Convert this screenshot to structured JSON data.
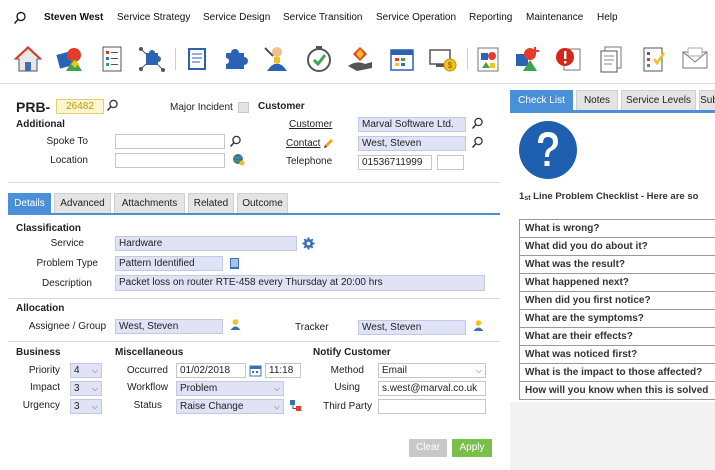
{
  "user": {
    "name": "Steven West"
  },
  "menu": [
    "Service Strategy",
    "Service Design",
    "Service Transition",
    "Service Operation",
    "Reporting",
    "Maintenance",
    "Help"
  ],
  "toolbar_icons": [
    "home-icon",
    "shapes-icon",
    "checklist-icon",
    "puzzle-network-icon",
    "document-icon",
    "puzzle-icon",
    "person-tool-icon",
    "clock-check-icon",
    "hand-diamond-icon",
    "calendar-icon",
    "monitor-money-icon",
    "shapes-report-icon",
    "shapes-add-icon",
    "alert-document-icon",
    "documents-icon",
    "checklist-doc-icon",
    "envelope-icon"
  ],
  "record": {
    "prefix": "PRB-",
    "number": "26482",
    "major_incident_label": "Major Incident"
  },
  "additional": {
    "heading": "Additional",
    "spoke_to_label": "Spoke To",
    "spoke_to_value": "",
    "location_label": "Location",
    "location_value": ""
  },
  "customer": {
    "heading": "Customer",
    "customer_label": "Customer",
    "customer_value": "Marval Software Ltd.",
    "contact_label": "Contact",
    "contact_value": "West, Steven",
    "telephone_label": "Telephone",
    "telephone_value": "01536711999",
    "extension_value": ""
  },
  "tabs": [
    "Details",
    "Advanced",
    "Attachments",
    "Related",
    "Outcome"
  ],
  "classification": {
    "heading": "Classification",
    "service_label": "Service",
    "service_value": "Hardware",
    "problem_type_label": "Problem Type",
    "problem_type_value": "Pattern Identified",
    "description_label": "Description",
    "description_value": "Packet loss on router RTE-458 every Thursday at 20:00 hrs"
  },
  "allocation": {
    "heading": "Allocation",
    "assignee_label": "Assignee / Group",
    "assignee_value": "West, Steven",
    "tracker_label": "Tracker",
    "tracker_value": "West, Steven"
  },
  "business": {
    "heading": "Business",
    "priority_label": "Priority",
    "priority_value": "4",
    "impact_label": "Impact",
    "impact_value": "3",
    "urgency_label": "Urgency",
    "urgency_value": "3"
  },
  "misc": {
    "heading": "Miscellaneous",
    "occurred_label": "Occurred",
    "occurred_date": "01/02/2018",
    "occurred_time": "11:18",
    "workflow_label": "Workflow",
    "workflow_value": "Problem",
    "status_label": "Status",
    "status_value": "Raise Change"
  },
  "notify": {
    "heading": "Notify Customer",
    "method_label": "Method",
    "method_value": "Email",
    "using_label": "Using",
    "using_value": "s.west@marval.co.uk",
    "third_party_label": "Third Party",
    "third_party_value": ""
  },
  "buttons": {
    "clear": "Clear",
    "apply": "Apply"
  },
  "right_panel": {
    "tabs": [
      "Check List",
      "Notes",
      "Service Levels",
      "Sub"
    ],
    "checklist_title_prefix": "1",
    "checklist_title_sup": "st",
    "checklist_title_rest": " Line Problem Checklist - Here are so",
    "questions": [
      "What is wrong?",
      "What did you do about it?",
      "What was the result?",
      "What happened next?",
      "When did you first notice?",
      "What are the symptoms?",
      "What are their effects?",
      "What was noticed first?",
      "What is the impact to those affected?",
      "How will you know when this is solved"
    ]
  },
  "colors": {
    "accent": "#4a90d9",
    "apply": "#78c04a",
    "field_blue": "#dfe3f5",
    "record_number": "#c89400"
  }
}
